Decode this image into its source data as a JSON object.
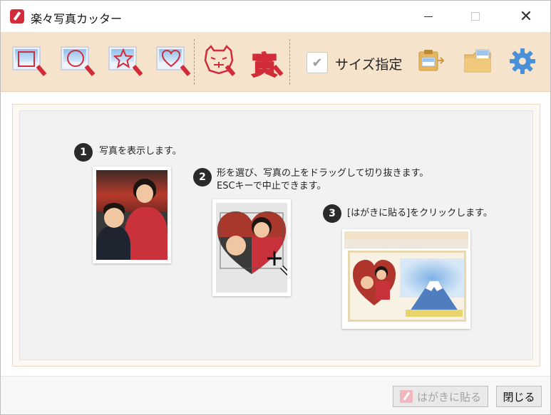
{
  "window": {
    "title": "楽々写真カッター"
  },
  "toolbar": {
    "size_label": "サイズ指定",
    "size_checked": true,
    "tools": [
      {
        "icon": "square-cut-icon"
      },
      {
        "icon": "circle-cut-icon"
      },
      {
        "icon": "star-cut-icon"
      },
      {
        "icon": "heart-cut-icon"
      },
      {
        "icon": "tiger-stamp-icon"
      },
      {
        "icon": "tora-kanji-stamp-icon"
      }
    ],
    "tiger_kanji": "寅"
  },
  "steps": [
    {
      "num": "1",
      "text": "写真を表示します。"
    },
    {
      "num": "2",
      "text_line1": "形を選び、写真の上をドラッグして切り抜きます。",
      "text_line2": "ESCキーで中止できます。"
    },
    {
      "num": "3",
      "text": "[はがきに貼る]をクリックします。"
    }
  ],
  "footer": {
    "paste_label": "はがきに貼る",
    "paste_enabled": false,
    "close_label": "閉じる"
  }
}
